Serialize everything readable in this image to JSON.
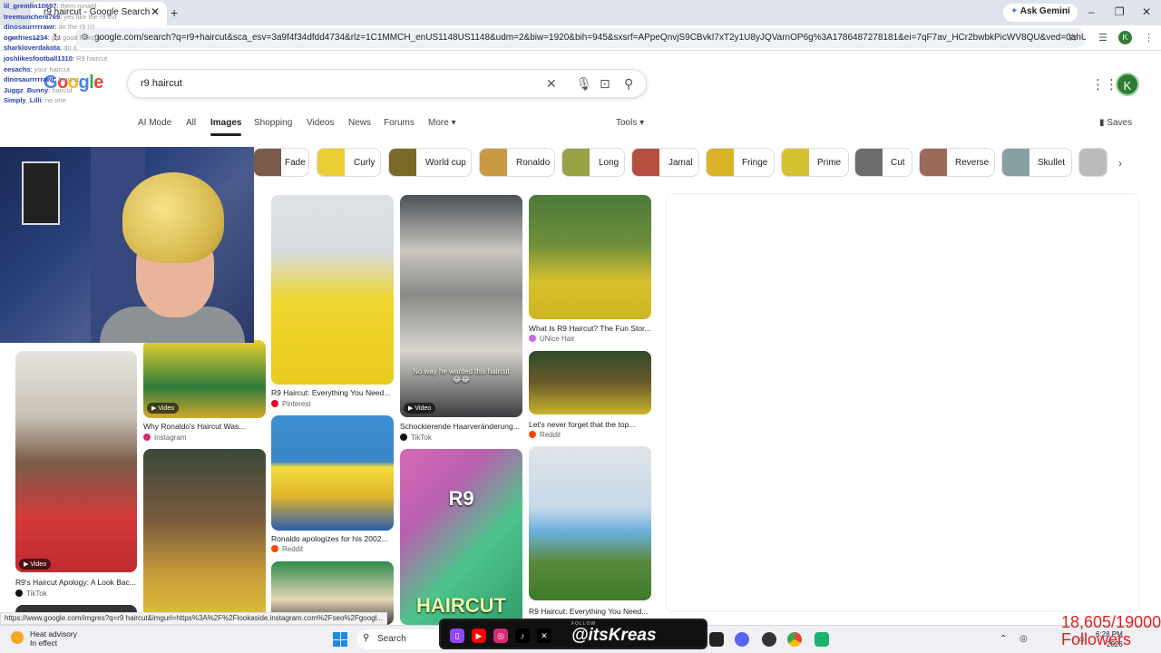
{
  "browser": {
    "tab_title": "r9 haircut - Google Search",
    "new_tab_glyph": "+",
    "close_glyph": "✕",
    "ask_gemini": "Ask Gemini",
    "url": "google.com/search?q=r9+haircut&sca_esv=3a9f4f34dfdd4734&rlz=1C1MMCH_enUS1148US1148&udm=2&biw=1920&bih=945&sxsrf=APpeQnvjS9CBvkI7xT2y1U8yJQVarnOP6g%3A1786487278181&ei=7qF7av_HCr2bwbkPicWV8QU&ved=0ahUKEwj_9vHcz...",
    "profile_initial": "K",
    "status_url": "https://www.google.com/imgres?q=r9 haircut&imgurl=https%3A%2F%2Flookaside.instagram.com%2Fseo%2Fgoogl..."
  },
  "google": {
    "query": "r9 haircut",
    "logo_letters": [
      "G",
      "o",
      "o",
      "g",
      "l",
      "e"
    ],
    "avatar_initial": "K",
    "tabs": [
      "AI Mode",
      "All",
      "Images",
      "Shopping",
      "Videos",
      "News",
      "Forums",
      "More"
    ],
    "active_tab": "Images",
    "tools_label": "Tools",
    "saves_label": "Saves",
    "chips": [
      "Fade",
      "Curly",
      "World cup",
      "Ronaldo",
      "Long",
      "Jamal",
      "Fringe",
      "Prime",
      "Cut",
      "Reverse",
      "Skullet"
    ]
  },
  "results": [
    {
      "caption": "R9 Haircut: Everything You Need...",
      "source": "Pinterest",
      "source_color": "#e60023"
    },
    {
      "caption": "Schockierende Haarveränderung...",
      "source": "TikTok",
      "source_color": "#111111",
      "video": "Video",
      "overlay": "No way he wanted this haircut😂😂"
    },
    {
      "caption": "What Is R9 Haircut? The Fun Stor...",
      "source": "UNice Hair",
      "source_color": "#c86dd7"
    },
    {
      "caption": "Let's never forget that the top...",
      "source": "Reddit",
      "source_color": "#ff4500"
    },
    {
      "caption": "Why Ronaldo's Haircut Was...",
      "source": "Instagram",
      "source_color": "#d62976",
      "video": "Video"
    },
    {
      "caption": "R9's Haircut Apology: A Look Bac...",
      "source": "TikTok",
      "source_color": "#111111",
      "video": "Video"
    },
    {
      "caption": "Ronaldo apologizes for his 2002...",
      "source": "Reddit",
      "source_color": "#ff4500"
    },
    {
      "caption": "R9 Haircut: Everything You Need...",
      "source": "",
      "source_color": "#888888"
    },
    {
      "overlay_top": "R9",
      "overlay_bottom": "HAIRCUT"
    }
  ],
  "chat": [
    {
      "user": "lil_gremlin10697",
      "msg": "them ronald"
    },
    {
      "user": "treemuncher6769",
      "msg": "yes like the r9 cut"
    },
    {
      "user": "dinosaurrrrrawr",
      "msg": "do the r9 !!!!"
    },
    {
      "user": "ogmfries1234",
      "msg": "get good haircut"
    },
    {
      "user": "sharkloverdakota",
      "msg": "do it"
    },
    {
      "user": "joshlikesfootball1310",
      "msg": "R9 haircut"
    },
    {
      "user": "eesachs",
      "msg": "your haircut"
    },
    {
      "user": "dinosaurrrrrawr",
      "msg": "haircut"
    },
    {
      "user": "Juggz_Bunny",
      "msg": "haircut"
    },
    {
      "user": "Simply_Lilli",
      "msg": "no one"
    }
  ],
  "taskbar": {
    "weather_title": "Heat advisory",
    "weather_sub": "In effect",
    "search_label": "Search",
    "handle": "@itsKreas",
    "follow_label": "FOLLOW",
    "time": "6:28 PM",
    "date": "2026",
    "followers_count": "18,605/19000",
    "followers_label": "Followers"
  },
  "colors": {
    "accent_blue": "#1a73e8",
    "avatar_green": "#2e7d32",
    "followers_red": "#e02020"
  }
}
